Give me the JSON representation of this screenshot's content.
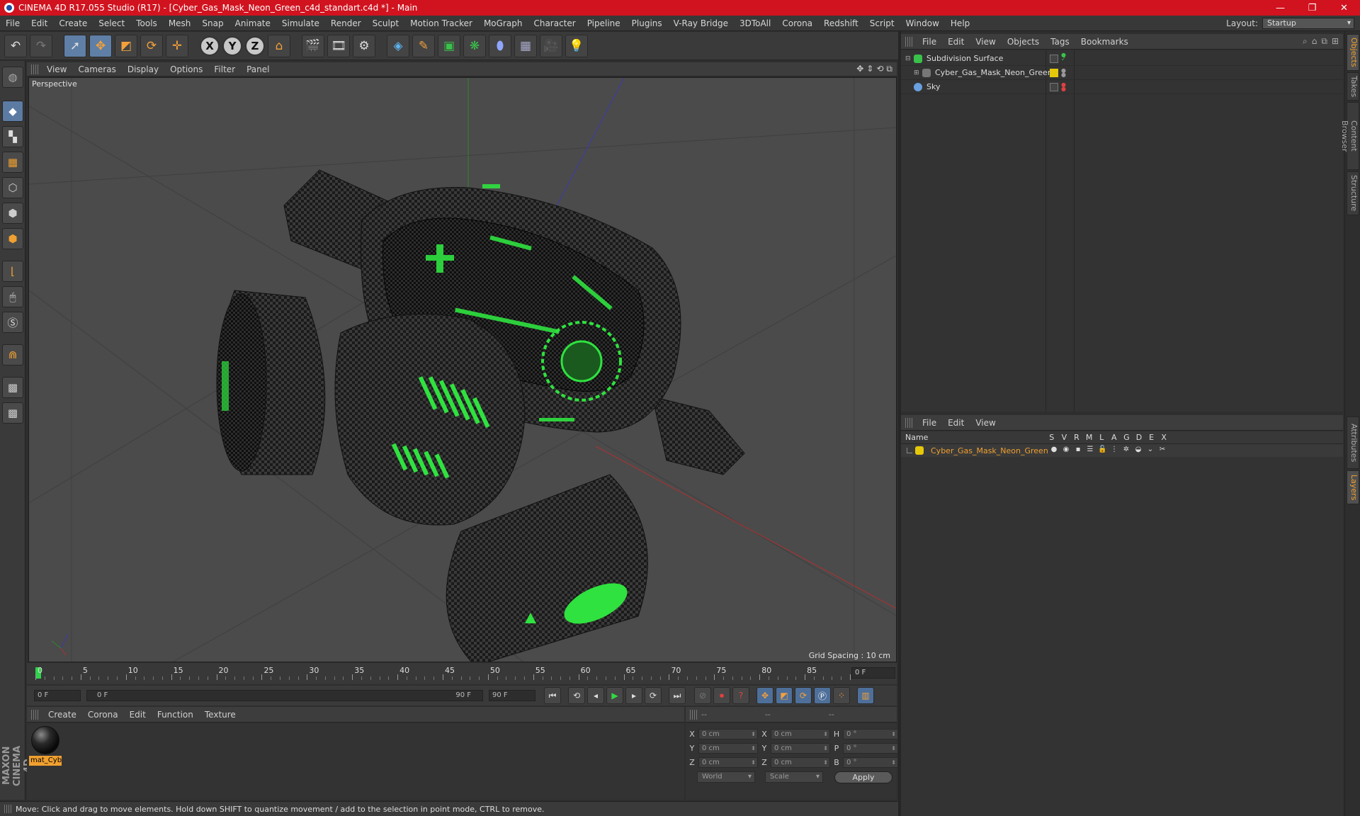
{
  "window": {
    "title": "CINEMA 4D R17.055 Studio (R17) - [Cyber_Gas_Mask_Neon_Green_c4d_standart.c4d *] - Main",
    "controls": [
      "—",
      "❐",
      "✕"
    ]
  },
  "menubar": {
    "items": [
      "File",
      "Edit",
      "Create",
      "Select",
      "Tools",
      "Mesh",
      "Snap",
      "Animate",
      "Simulate",
      "Render",
      "Sculpt",
      "Motion Tracker",
      "MoGraph",
      "Character",
      "Pipeline",
      "Plugins",
      "V-Ray Bridge",
      "3DToAll",
      "Corona",
      "Redshift",
      "Script",
      "Window",
      "Help"
    ],
    "layout_label": "Layout:",
    "layout_value": "Startup"
  },
  "toolbar": {
    "axis_x": "X",
    "axis_y": "Y",
    "axis_z": "Z"
  },
  "viewport": {
    "menu": [
      "View",
      "Cameras",
      "Display",
      "Options",
      "Filter",
      "Panel"
    ],
    "label": "Perspective",
    "grid_spacing": "Grid Spacing : 10 cm"
  },
  "timeline": {
    "ticks": [
      "0",
      "5",
      "10",
      "15",
      "20",
      "25",
      "30",
      "35",
      "40",
      "45",
      "50",
      "55",
      "60",
      "65",
      "70",
      "75",
      "80",
      "85",
      "90"
    ],
    "end_field": "0 F",
    "current_frame": "0 F",
    "range_start": "0 F",
    "range_end": "90 F",
    "max_frame": "90 F"
  },
  "material_manager": {
    "menu": [
      "Create",
      "Corona",
      "Edit",
      "Function",
      "Texture"
    ],
    "material_name": "mat_Cyb"
  },
  "coordinates": {
    "header": [
      "--",
      "--",
      "--"
    ],
    "rows": [
      {
        "a": "X",
        "av": "0 cm",
        "b": "X",
        "bv": "0 cm",
        "c": "H",
        "cv": "0 °"
      },
      {
        "a": "Y",
        "av": "0 cm",
        "b": "Y",
        "bv": "0 cm",
        "c": "P",
        "cv": "0 °"
      },
      {
        "a": "Z",
        "av": "0 cm",
        "b": "Z",
        "bv": "0 cm",
        "c": "B",
        "cv": "0 °"
      }
    ],
    "space": "World",
    "mode": "Scale",
    "apply": "Apply"
  },
  "status": "Move: Click and drag to move elements. Hold down SHIFT to quantize movement / add to the selection in point mode, CTRL to remove.",
  "object_manager": {
    "menu": [
      "File",
      "Edit",
      "View",
      "Objects",
      "Tags",
      "Bookmarks"
    ],
    "objects": [
      {
        "name": "Subdivision Surface",
        "color": "#39c24a"
      },
      {
        "name": "Cyber_Gas_Mask_Neon_Green",
        "color": "#e0e0e0"
      },
      {
        "name": "Sky",
        "color": "#6aa0e0"
      }
    ]
  },
  "layer_manager": {
    "menu": [
      "File",
      "Edit",
      "View"
    ],
    "headers": [
      "Name",
      "S",
      "V",
      "R",
      "M",
      "L",
      "A",
      "G",
      "D",
      "E",
      "X"
    ],
    "layer_name": "Cyber_Gas_Mask_Neon_Green",
    "layer_color": "#e6c80a"
  },
  "side_tabs": [
    "Objects",
    "Takes",
    "Content Browser",
    "Structure",
    "Attributes",
    "Layers"
  ],
  "brand": "MAXON CINEMA 4D",
  "colors": {
    "accent": "#f0a030",
    "title_bar": "#d1131f",
    "neon": "#2fe23f"
  }
}
